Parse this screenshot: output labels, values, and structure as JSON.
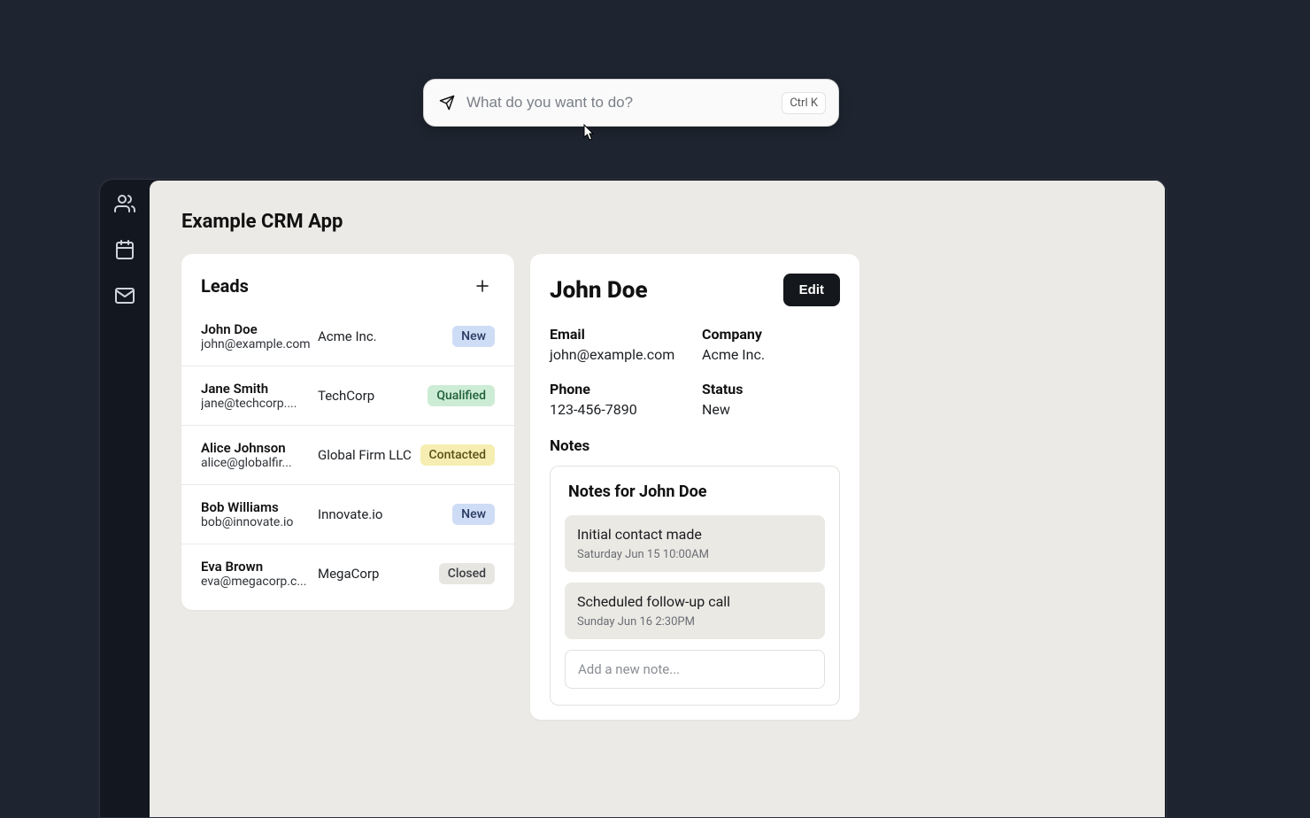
{
  "command_bar": {
    "placeholder": "What do you want to do?",
    "shortcut": "Ctrl K"
  },
  "app": {
    "title": "Example CRM App"
  },
  "leads_panel": {
    "title": "Leads"
  },
  "leads": [
    {
      "name": "John Doe",
      "email": "john@example.com",
      "company": "Acme Inc.",
      "status": "New",
      "badge_class": "badge-new"
    },
    {
      "name": "Jane Smith",
      "email": "jane@techcorp....",
      "company": "TechCorp",
      "status": "Qualified",
      "badge_class": "badge-qualified"
    },
    {
      "name": "Alice Johnson",
      "email": "alice@globalfir...",
      "company": "Global Firm LLC",
      "status": "Contacted",
      "badge_class": "badge-contacted"
    },
    {
      "name": "Bob Williams",
      "email": "bob@innovate.io",
      "company": "Innovate.io",
      "status": "New",
      "badge_class": "badge-new"
    },
    {
      "name": "Eva Brown",
      "email": "eva@megacorp.c...",
      "company": "MegaCorp",
      "status": "Closed",
      "badge_class": "badge-closed"
    }
  ],
  "detail": {
    "name": "John Doe",
    "edit_label": "Edit",
    "fields": {
      "email_label": "Email",
      "email_value": "john@example.com",
      "company_label": "Company",
      "company_value": "Acme Inc.",
      "phone_label": "Phone",
      "phone_value": "123-456-7890",
      "status_label": "Status",
      "status_value": "New"
    },
    "notes_label": "Notes",
    "notes_title": "Notes for John Doe",
    "notes": [
      {
        "text": "Initial contact made",
        "time": "Saturday Jun 15 10:00AM"
      },
      {
        "text": "Scheduled follow-up call",
        "time": "Sunday Jun 16 2:30PM"
      }
    ],
    "add_note_placeholder": "Add a new note..."
  }
}
